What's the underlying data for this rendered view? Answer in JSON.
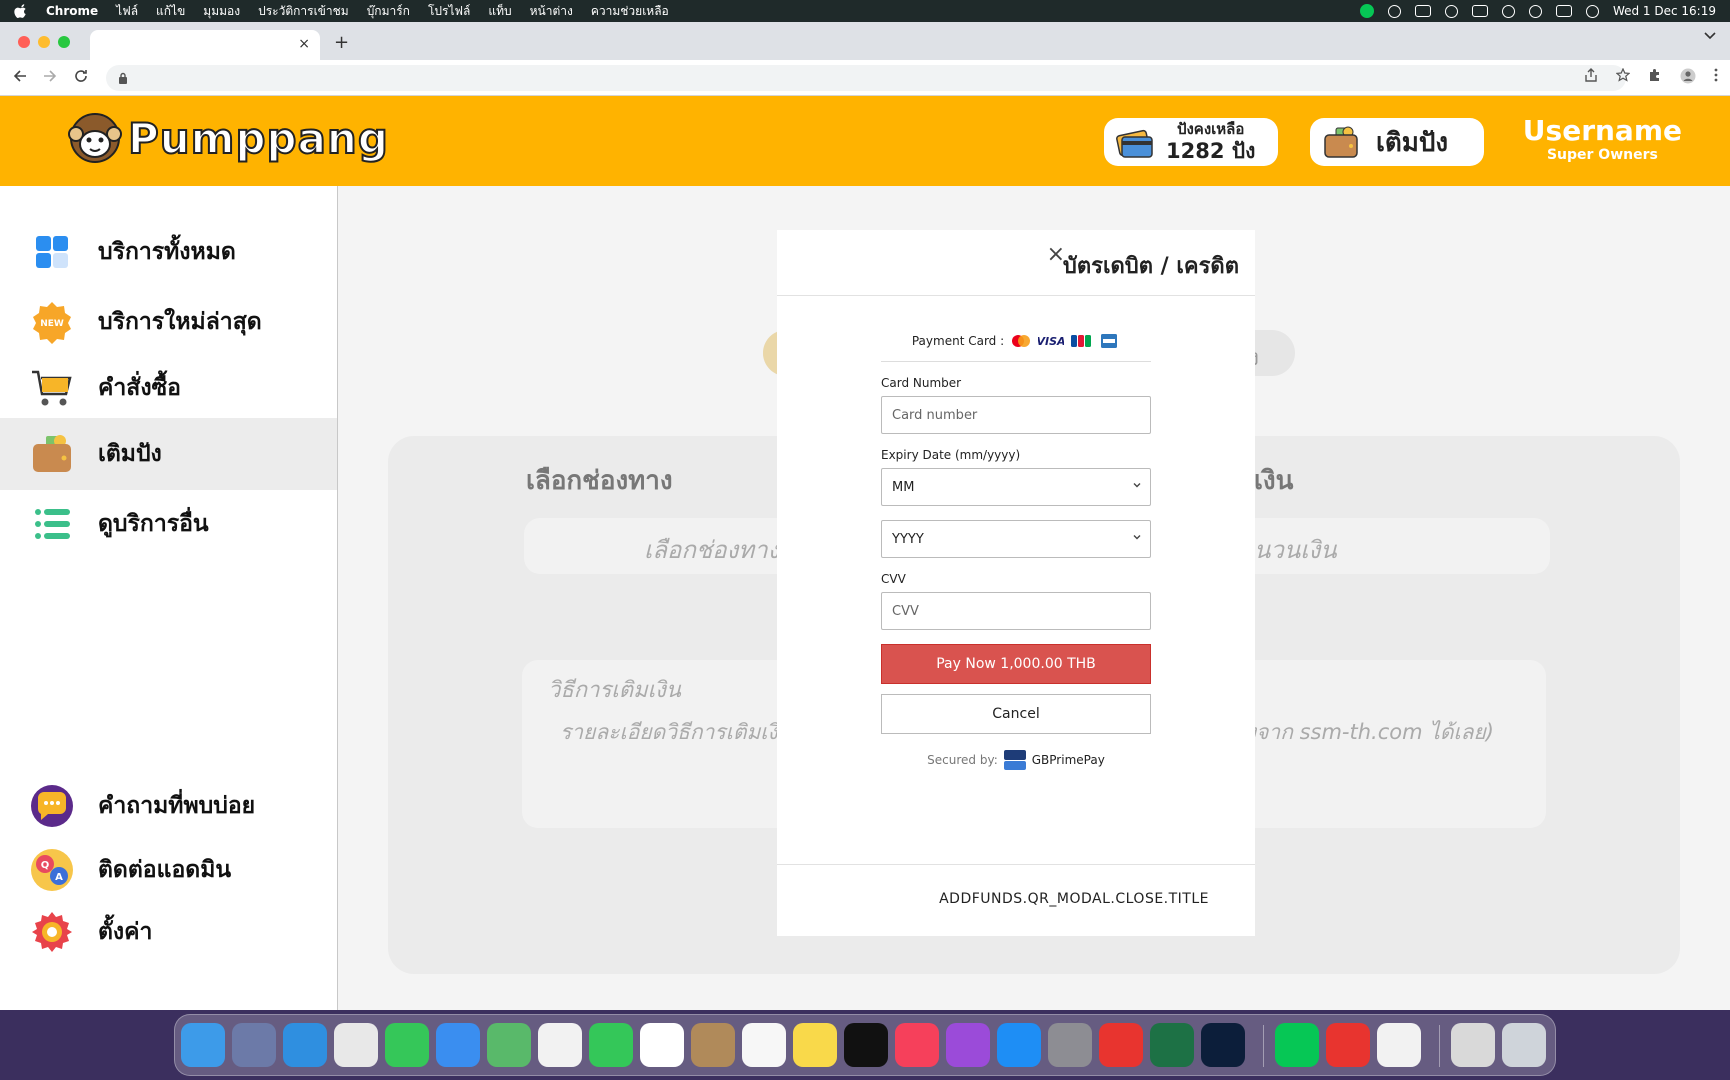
{
  "menubar": {
    "app": "Chrome",
    "items": [
      "ไฟล์",
      "แก้ไข",
      "มุมมอง",
      "ประวัติการเข้าชม",
      "บุ๊กมาร์ก",
      "โปรไฟล์",
      "แท็บ",
      "หน้าต่าง",
      "ความช่วยเหลือ"
    ],
    "clock": "Wed 1 Dec  16:19"
  },
  "browser": {
    "tab_close": "×",
    "new_tab": "+"
  },
  "header": {
    "logo_text": "Pumppang",
    "balance_label": "ปังคงเหลือ",
    "balance_value": "1282 ปัง",
    "topup_label": "เติมปัง",
    "username": "Username",
    "role": "Super Owners"
  },
  "sidebar": {
    "items": [
      {
        "label": "บริการทั้งหมด",
        "icon": "grid-icon"
      },
      {
        "label": "บริการใหม่ล่าสุด",
        "icon": "new-badge-icon"
      },
      {
        "label": "คำสั่งซื้อ",
        "icon": "cart-icon"
      },
      {
        "label": "เติมปัง",
        "icon": "wallet-icon",
        "active": true
      },
      {
        "label": "ดูบริการอื่น",
        "icon": "list-icon"
      },
      {
        "label": "คำถามที่พบบ่อย",
        "icon": "chat-icon"
      },
      {
        "label": "ติดต่อแอดมิน",
        "icon": "qa-icon"
      },
      {
        "label": "ตั้งค่า",
        "icon": "gear-icon"
      }
    ]
  },
  "main": {
    "balance_suffix": "ปัง",
    "channel_title": "เลือกช่องทาง",
    "channel_placeholder": "เลือกช่องทาง",
    "amount_title": "เงิน",
    "amount_placeholder": "นวนเงิน",
    "method_title": "วิธีการเติมเงิน",
    "method_detail_left": "รายละเอียดวิธีการเติมเงิ",
    "method_detail_right": "ทางจาก ssm-th.com ได้เลย)"
  },
  "modal": {
    "close_symbol": "×",
    "title": "บัตรเดบิต / เครดิต",
    "payment_card_label": "Payment Card :",
    "card_brands": [
      "mastercard-icon",
      "visa-icon",
      "jcb-icon",
      "amex-icon"
    ],
    "card_number_label": "Card Number",
    "card_number_placeholder": "Card number",
    "expiry_label": "Expiry Date (mm/yyyy)",
    "month_value": "MM",
    "year_value": "YYYY",
    "cvv_label": "CVV",
    "cvv_placeholder": "CVV",
    "pay_button": "Pay Now 1,000.00 THB",
    "cancel_button": "Cancel",
    "secured_by": "Secured by:",
    "provider": "GBPrimePay",
    "footer_close": "ADDFUNDS.QR_MODAL.CLOSE.TITLE"
  },
  "colors": {
    "brand": "#ffb300",
    "pay_button": "#d9534f"
  }
}
